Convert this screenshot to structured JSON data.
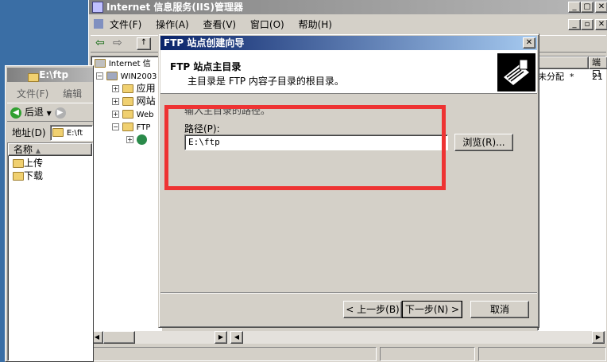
{
  "iis": {
    "title": "Internet 信息服务(IIS)管理器",
    "menu": [
      "文件(F)",
      "操作(A)",
      "查看(V)",
      "窗口(O)",
      "帮助(H)"
    ],
    "tree": [
      "Internet 信",
      "WIN2003",
      "应用",
      "网站",
      "Web",
      "FTP"
    ],
    "col_port": "端口",
    "row_status": "未分配",
    "row_star": "*",
    "row_port": "21"
  },
  "explorer": {
    "title": "E:\\ftp",
    "menu": [
      "文件(F)",
      "编辑"
    ],
    "back_label": "后退",
    "address_label": "地址(D)",
    "address_value": "E:\\ft",
    "col_name": "名称",
    "items": [
      "上传",
      "下载"
    ]
  },
  "wizard": {
    "title": "FTP 站点创建向导",
    "heading": "FTP 站点主目录",
    "subheading": "主目录是 FTP 内容子目录的根目录。",
    "prompt": "输入主目录的路径。",
    "path_label": "路径(P):",
    "path_value": "E:\\ftp",
    "browse_label": "浏览(R)...",
    "back_label": "< 上一步(B)",
    "next_label": "下一步(N) >",
    "cancel_label": "取消"
  },
  "colors": {
    "title_active": "#0a246a",
    "title_inactive": "#808080",
    "highlight": "#ee3333"
  }
}
